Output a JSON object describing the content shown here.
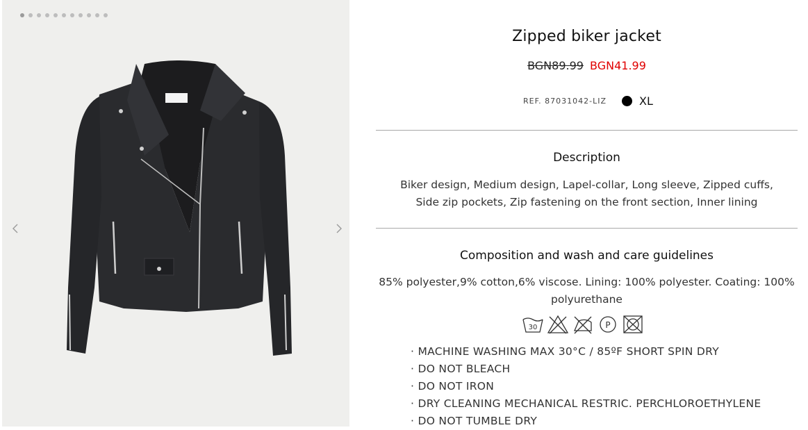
{
  "gallery": {
    "dot_count": 11,
    "active_dot": 0,
    "prev_icon": "chevron-left-icon",
    "next_icon": "chevron-right-icon"
  },
  "product": {
    "title": "Zipped biker jacket",
    "old_price": "BGN89.99",
    "new_price": "BGN41.99",
    "ref": "REF. 87031042-LIZ",
    "color_hex": "#000000",
    "size": "XL"
  },
  "description": {
    "heading": "Description",
    "line1": "Biker design, Medium design, Lapel-collar, Long sleeve, Zipped cuffs,",
    "line2": "Side zip pockets, Zip fastening on the front section, Inner lining"
  },
  "composition": {
    "heading": "Composition and wash and care guidelines",
    "line1": "85% polyester,9% cotton,6% viscose. Lining: 100% polyester. Coating: 100%",
    "line2": "polyurethane",
    "wash_icon_temp": "30",
    "dryclean_icon_letter": "P",
    "care_icons": [
      "wash-30-icon",
      "no-bleach-icon",
      "no-iron-icon",
      "dry-clean-p-icon",
      "no-tumble-dry-icon"
    ],
    "care_items": [
      "MACHINE WASHING MAX 30°C / 85ºF SHORT SPIN DRY",
      "DO NOT BLEACH",
      "DO NOT IRON",
      "DRY CLEANING MECHANICAL RESTRIC. PERCHLOROETHYLENE",
      "DO NOT TUMBLE DRY"
    ]
  },
  "colors": {
    "sale_price": "#e00000",
    "divider": "#a8a8a8",
    "gallery_bg": "#efefed"
  }
}
